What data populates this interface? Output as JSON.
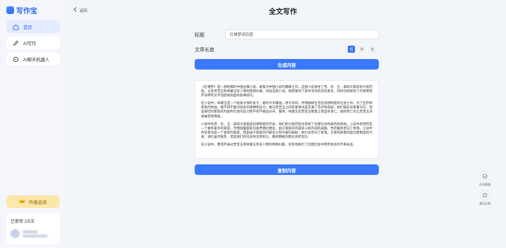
{
  "app": {
    "name": "写作宝"
  },
  "sidebar": {
    "items": [
      {
        "label": "首页",
        "icon": "home-icon"
      },
      {
        "label": "AI写作",
        "icon": "pen-icon"
      },
      {
        "label": "AI聊天机器人",
        "icon": "chat-icon"
      }
    ],
    "upgrade_label": "升级会员",
    "usage_text": "已使用 2/5次"
  },
  "header": {
    "back_label": "返回",
    "title": "全文写作"
  },
  "form": {
    "title_label": "标题",
    "title_value": "红楼梦读后感",
    "length_label": "文章长度",
    "length_options": [
      "短",
      "中",
      "长"
    ],
    "length_selected": "短",
    "generate_label": "生成内容"
  },
  "content": {
    "paragraphs": [
      "《红楼梦》是一部经典的中国古典小说，被誉为中国小说的巅峰之作。这部小说讲述了贾、史、王、薛四大家族的兴衰历程，以及贾宝玉和林黛玉等人物的情感纠葛。阅读这部小说，我感受到了其中深深的悲欢离合，同时也感受到了作者曹雪芹深厚的文学功底和高超的叙事技巧。",
      "在小说中，林黛玉是一个极具才情的女子，她的才华横溢，善于诗词，然而她却生活在封建制度的社会之中，为了生存和家族的利益，她不得不面对很多的束缚和压力。她与贾宝玉之间的爱情也是充满了无奈和悲剧，他们彼此深爱着对方，但是却因为家族的利益和社会的压力而不得不被迫分开。最终，林黛玉在贾宝玉娶妻之夜自杀身亡，她的死亡也让贾宝玉深感痛苦和悔恨。",
      "小说中的贾、史、王、薛四大家族是封建制度的代表，他们的兴衰历程也反映了封建社会的腐朽和衰败。小说中的贾府是一个奢侈豪华的家庭，然而随着家族内部矛盾的激化，由于家族的内部争斗和外部的威胁，贾府最终走向了衰落。小说中的史家也是一个富有的家庭，但是由于家族的内部争斗和外部的威胁，他们也走向了衰落。王家和薛家则是封建制度的代表，他们虽然富有，但是他们的社会地位和权力，最终都被封建社会所淘汰。",
      "在小说中，曹雪芹通过贾宝玉和林黛玉等多人物的情感纠葛，深刻地揭示了封建社会中青年男女的不幸命运。"
    ],
    "copy_label": "复制内容"
  },
  "floating": {
    "feedback_label": "在线客服",
    "report_label": "意见反馈"
  },
  "colors": {
    "accent": "#3a78ff",
    "upgrade_bg": "#fbe7a9"
  }
}
